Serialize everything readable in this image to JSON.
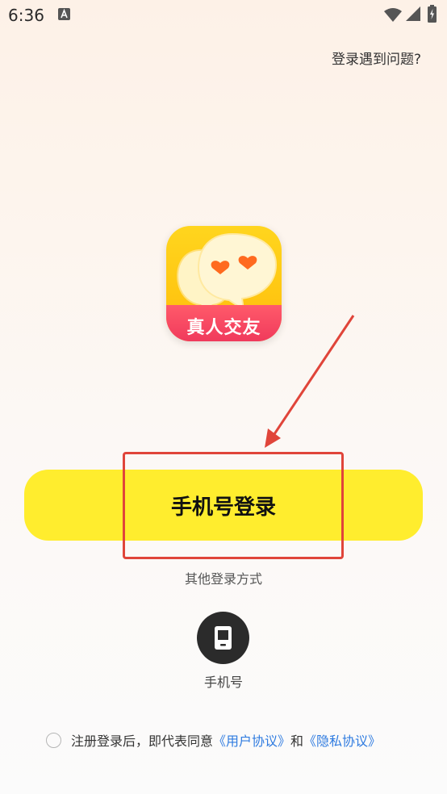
{
  "status_bar": {
    "time": "6:36",
    "icons": [
      "a-notification-icon",
      "wifi-icon",
      "signal-icon",
      "battery-charging-icon"
    ]
  },
  "header": {
    "help_link": "登录遇到问题?"
  },
  "logo": {
    "text": "真人交友",
    "icon": "chat-bubbles-hearts-icon"
  },
  "login": {
    "primary_button": "手机号登录",
    "other_methods_label": "其他登录方式",
    "methods": [
      {
        "label": "手机号",
        "icon": "phone-icon"
      }
    ]
  },
  "agreement": {
    "prefix": "注册登录后，即代表同意",
    "user_agreement": "《用户协议》",
    "conjunction": "和",
    "privacy_policy": "《隐私协议》"
  },
  "colors": {
    "primary_button": "#ffed2e",
    "annotation_red": "#e0453a",
    "link": "#2f7be0",
    "logo_yellow": "#ffc712",
    "logo_banner": "#f03a5c"
  }
}
